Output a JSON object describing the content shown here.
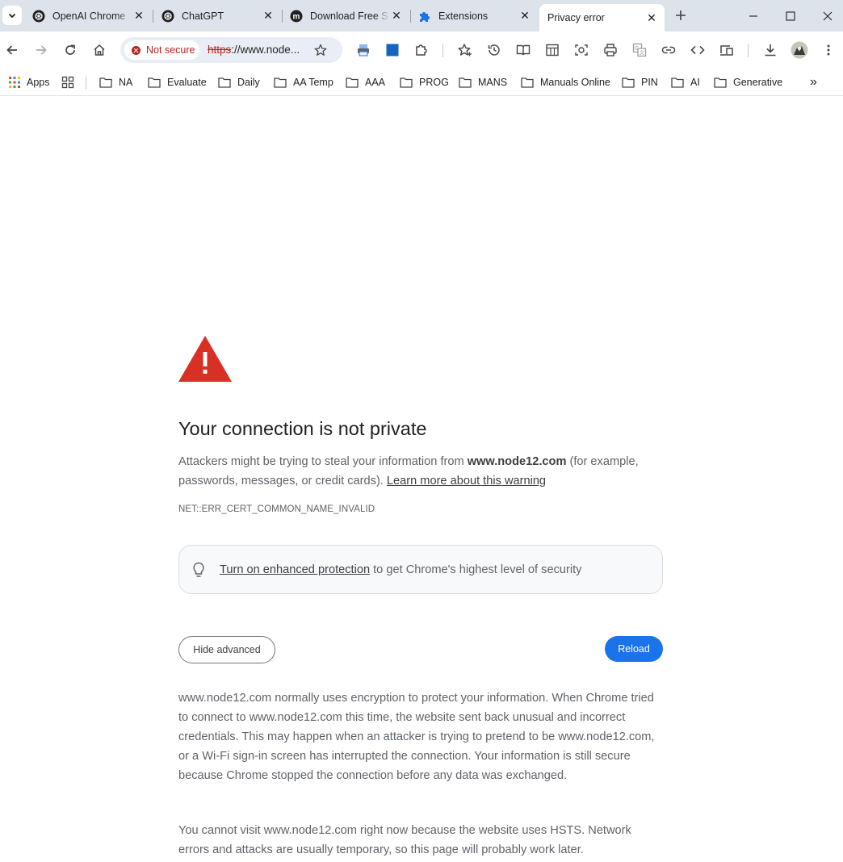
{
  "browser": {
    "tabs": [
      {
        "title": "OpenAI Chrome",
        "favicon": "openai-icon"
      },
      {
        "title": "ChatGPT",
        "favicon": "openai-icon"
      },
      {
        "title": "Download Free S",
        "favicon": "m-icon"
      },
      {
        "title": "Extensions",
        "favicon": "puzzle-icon"
      },
      {
        "title": "Privacy error",
        "favicon": "none",
        "active": true
      }
    ],
    "omnibox": {
      "security_label": "Not secure",
      "url_scheme": "https",
      "url_rest": "://www.node...",
      "full_url": "https://www.node12.com"
    },
    "toolbar_icons": [
      "back-icon",
      "forward-icon",
      "reload-icon",
      "home-icon",
      "bookmark-star-icon",
      "extension-printer-icon",
      "extension-blue-square-icon",
      "extensions-puzzle-icon",
      "favorites-icon",
      "history-icon",
      "reading-mode-icon",
      "tab-layout-icon",
      "screenshot-icon",
      "print-icon",
      "translate-icon",
      "copy-link-icon",
      "view-source-icon",
      "cast-icon",
      "downloads-icon",
      "profile-avatar",
      "menu-icon"
    ],
    "bookmarks": [
      "Apps",
      "NA",
      "Evaluate",
      "Daily",
      "AA Temp",
      "AAA",
      "PROG",
      "MANS",
      "Manuals Online",
      "PIN",
      "AI",
      "Generative"
    ],
    "overflow_label": "»"
  },
  "page": {
    "heading": "Your connection is not private",
    "intro_before": "Attackers might be trying to steal your information from ",
    "intro_domain": "www.node12.com",
    "intro_after": " (for example, passwords, messages, or credit cards). ",
    "learn_more": "Learn more about this warning",
    "error_code": "NET::ERR_CERT_COMMON_NAME_INVALID",
    "enhanced_link": "Turn on enhanced protection",
    "enhanced_rest": " to get Chrome's highest level of security",
    "hide_advanced": "Hide advanced",
    "reload": "Reload",
    "advanced_p1": "www.node12.com normally uses encryption to protect your information. When Chrome tried to connect to www.node12.com this time, the website sent back unusual and incorrect credentials. This may happen when an attacker is trying to pretend to be www.node12.com, or a Wi-Fi sign-in screen has interrupted the connection. Your information is still secure because Chrome stopped the connection before any data was exchanged.",
    "advanced_p2": "You cannot visit www.node12.com right now because the website uses HSTS. Network errors and attacks are usually temporary, so this page will probably work later."
  },
  "colors": {
    "warning_red": "#d93025",
    "primary_blue": "#1a73e8",
    "not_secure_red": "#b3261e",
    "tabstrip_bg": "#dde3ea"
  }
}
